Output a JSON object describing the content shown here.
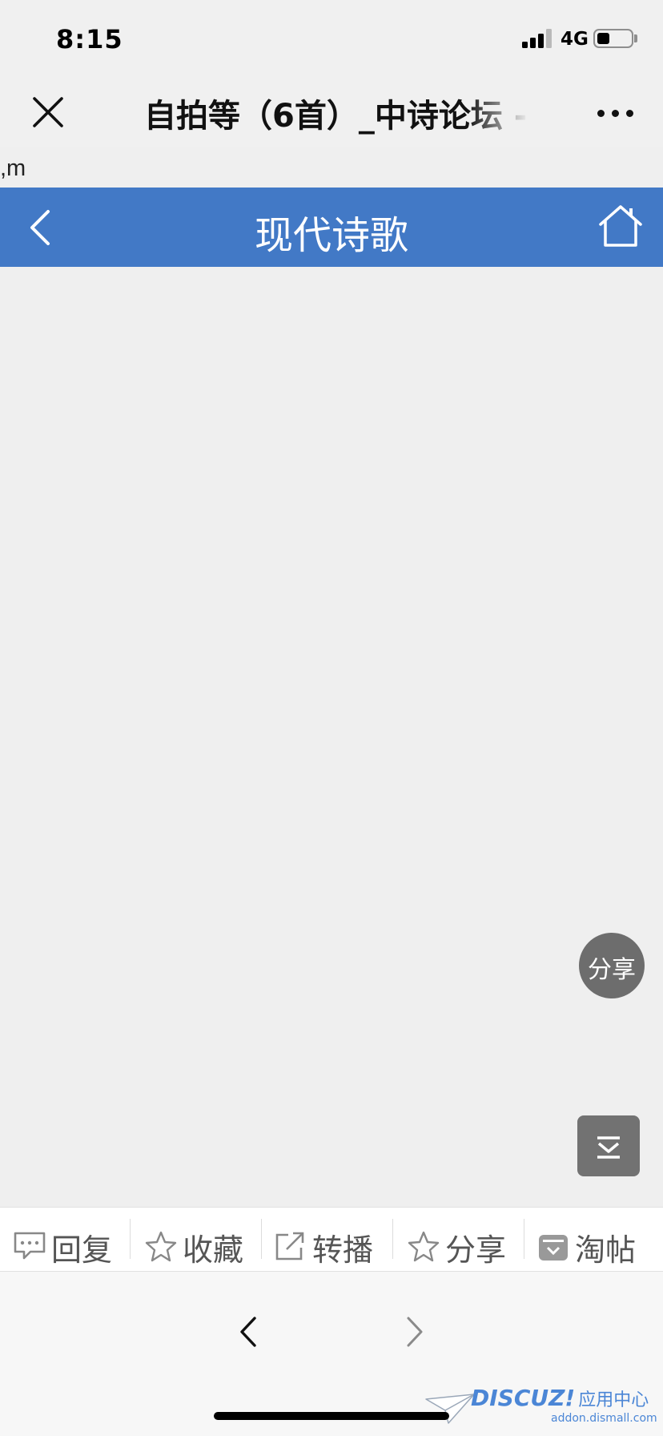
{
  "status_bar": {
    "time": "8:15",
    "network": "4G"
  },
  "nav_bar": {
    "title": "自拍等（6首）_中诗论坛 -",
    "close_icon": "close-icon",
    "more_icon": "more-dots-icon"
  },
  "stray_text": ",m",
  "forum_header": {
    "title": "现代诗歌",
    "back_icon": "chevron-left-icon",
    "home_icon": "home-icon",
    "background": "#4279c6"
  },
  "floating": {
    "share_label": "分享",
    "scroll_bottom_icon": "scroll-to-bottom-icon"
  },
  "action_bar": {
    "items": [
      {
        "label": "回复",
        "icon": "comment-icon"
      },
      {
        "label": "收藏",
        "icon": "star-icon"
      },
      {
        "label": "转播",
        "icon": "forward-icon"
      },
      {
        "label": "分享",
        "icon": "star-icon"
      },
      {
        "label": "淘帖",
        "icon": "collect-box-icon"
      }
    ]
  },
  "browser_bar": {
    "prev_icon": "chevron-left-icon",
    "next_icon": "chevron-right-icon"
  },
  "watermark": {
    "brand": "DISCUZ!",
    "brand_cn": "应用中心",
    "domain": "addon.dismall.com"
  }
}
